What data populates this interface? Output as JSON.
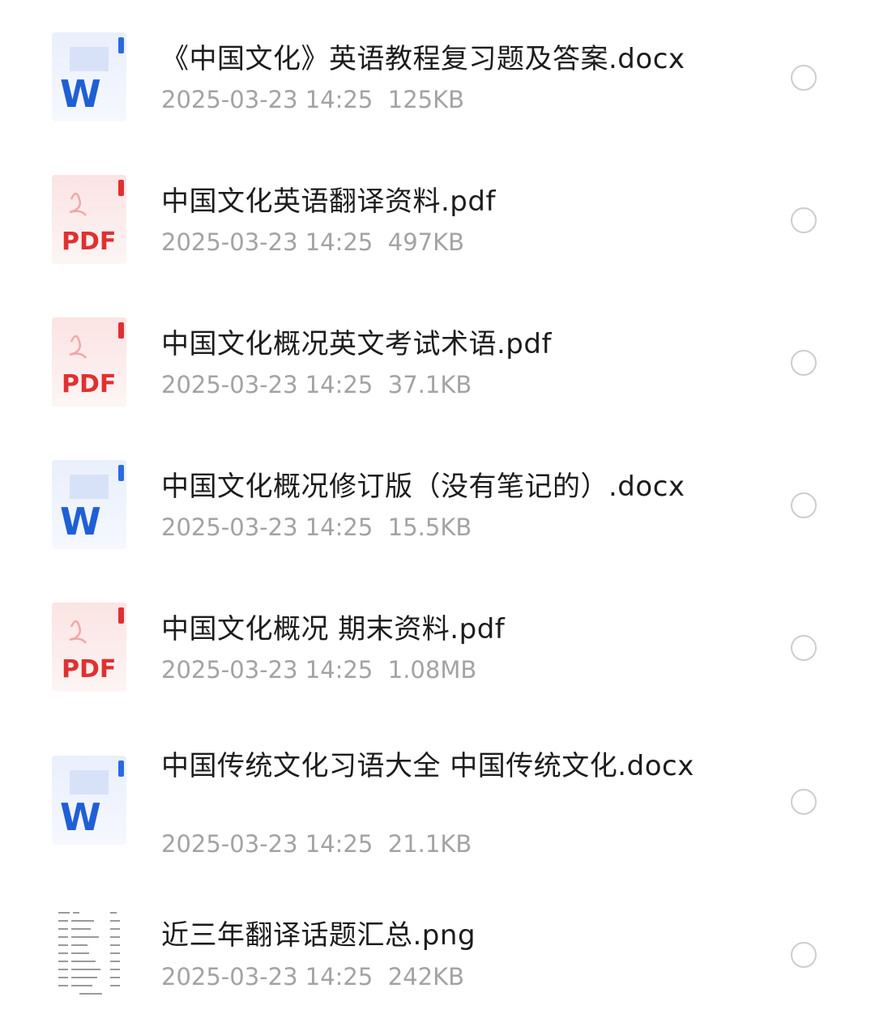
{
  "files": [
    {
      "type": "docx",
      "icon": "word-doc-icon",
      "name": "《中国文化》英语教程复习题及答案.docx",
      "date": "2025-03-23 14:25",
      "size": "125KB"
    },
    {
      "type": "pdf",
      "icon": "pdf-icon",
      "name": "中国文化英语翻译资料.pdf",
      "date": "2025-03-23 14:25",
      "size": "497KB"
    },
    {
      "type": "pdf",
      "icon": "pdf-icon",
      "name": "中国文化概况英文考试术语.pdf",
      "date": "2025-03-23 14:25",
      "size": "37.1KB"
    },
    {
      "type": "docx",
      "icon": "word-doc-icon",
      "name": "中国文化概况修订版（没有笔记的）.docx",
      "date": "2025-03-23 14:25",
      "size": "15.5KB"
    },
    {
      "type": "pdf",
      "icon": "pdf-icon",
      "name": "中国文化概况 期末资料.pdf",
      "date": "2025-03-23 14:25",
      "size": "1.08MB"
    },
    {
      "type": "docx",
      "icon": "word-doc-icon",
      "name": "中国传统文化习语大全 中国传统文化.docx",
      "date": "2025-03-23 14:25",
      "size": "21.1KB"
    },
    {
      "type": "png",
      "icon": "image-thumbnail-icon",
      "name": "近三年翻译话题汇总.png",
      "date": "2025-03-23 14:25",
      "size": "242KB"
    }
  ],
  "icon_labels": {
    "docx": "W",
    "pdf": "PDF"
  },
  "colors": {
    "word_blue": "#1f5fd6",
    "pdf_red": "#e03030",
    "meta_gray": "#a3a3a3"
  }
}
